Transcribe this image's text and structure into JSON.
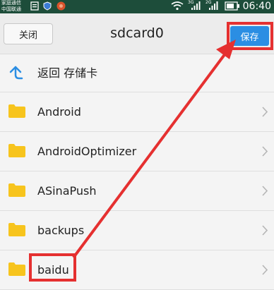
{
  "status_bar": {
    "carrier_1": "家庭通信",
    "carrier_2": "中国联通",
    "time": "06:40",
    "signal_label_1": "3G",
    "signal_label_2": "2G"
  },
  "header": {
    "close_label": "关闭",
    "title": "sdcard0",
    "save_label": "保存"
  },
  "list": {
    "back_label": "返回 存储卡",
    "items": [
      {
        "label": "Android",
        "icon": "folder-icon"
      },
      {
        "label": "AndroidOptimizer",
        "icon": "folder-icon"
      },
      {
        "label": "ASinaPush",
        "icon": "folder-icon"
      },
      {
        "label": "backups",
        "icon": "folder-icon"
      },
      {
        "label": "baidu",
        "icon": "folder-icon"
      }
    ]
  },
  "colors": {
    "accent": "#2b8ee3",
    "annotation": "#e53030",
    "folder": "#f7c41d",
    "status_bar": "#1d4d3a"
  }
}
